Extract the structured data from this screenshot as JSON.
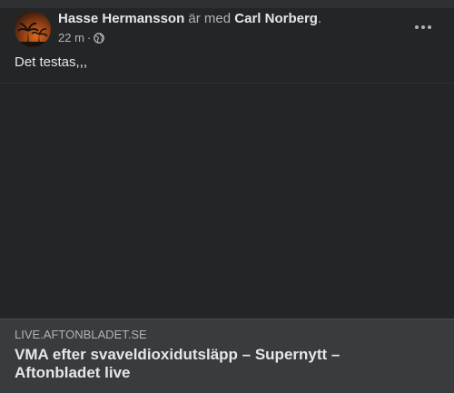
{
  "post": {
    "author": "Hasse Hermansson",
    "with_text": "är med",
    "tagged": "Carl Norberg",
    "period": ".",
    "time": "22 m",
    "separator": "·",
    "privacy_icon": "globe-icon",
    "text": "Det testas,,,"
  },
  "link_preview": {
    "domain": "LIVE.AFTONBLADET.SE",
    "title": "VMA efter svaveldioxidutsläpp – Supernytt – Aftonbladet live"
  },
  "colors": {
    "background": "#242526",
    "preview_background": "#3a3b3c",
    "primary_text": "#e4e6eb",
    "secondary_text": "#b0b3b8"
  }
}
